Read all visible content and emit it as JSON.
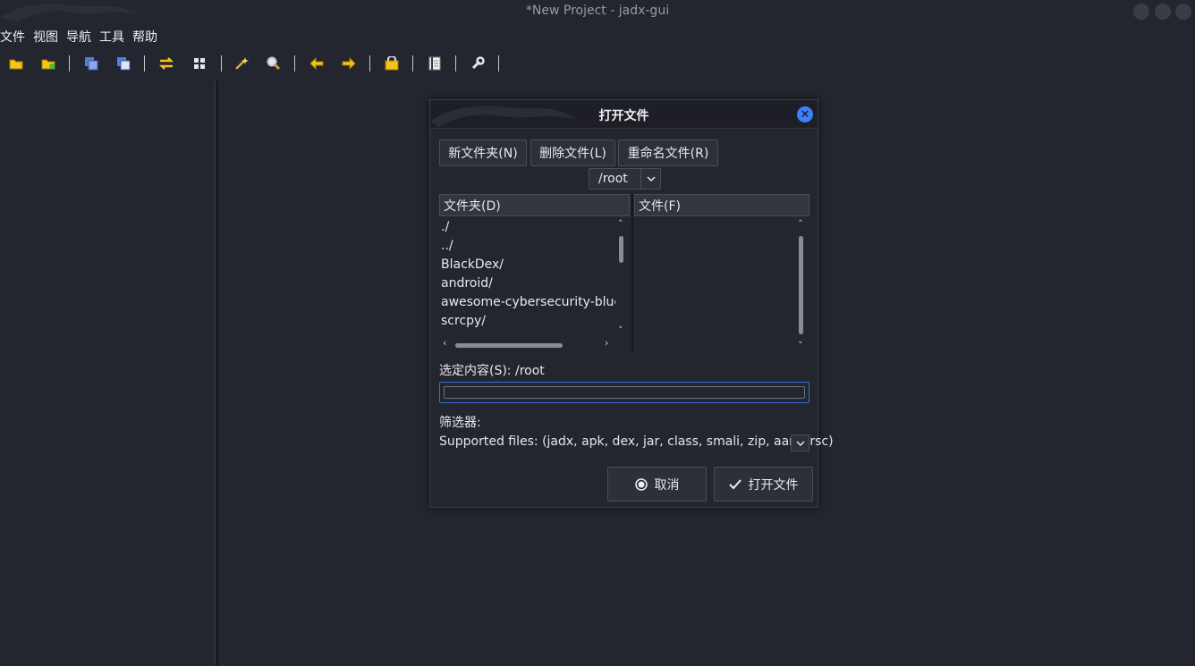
{
  "window": {
    "title": "*New Project - jadx-gui"
  },
  "menu": [
    "文件",
    "视图",
    "导航",
    "工具",
    "帮助"
  ],
  "toolbar": {
    "icons": [
      "open-file-icon",
      "add-files-icon",
      "save-all-icon",
      "export-icon",
      "sync-icon",
      "flatten-packages-icon",
      "decompile-all-icon",
      "search-icon",
      "back-icon",
      "forward-icon",
      "deobfuscation-icon",
      "log-viewer-icon",
      "preferences-icon"
    ]
  },
  "dialog": {
    "title": "打开文件",
    "new_folder": "新文件夹(N)",
    "delete_file": "删除文件(L)",
    "rename_file": "重命名文件(R)",
    "path": "/root",
    "folders_header": "文件夹(D)",
    "files_header": "文件(F)",
    "folders": [
      "./",
      "../",
      "BlackDex/",
      "android/",
      "awesome-cybersecurity-blue",
      "scrcpy/"
    ],
    "selection_label": "选定内容(S): /root",
    "selection_value": "",
    "filter_label": "筛选器:",
    "filter_value": "Supported files: (jadx, apk, dex, jar, class, smali, zip, aar, arsc)",
    "cancel": "取消",
    "open": "打开文件"
  },
  "colors": {
    "background": "#23252f",
    "accent": "#3b82f6",
    "icon_yellow": "#f5c518"
  }
}
